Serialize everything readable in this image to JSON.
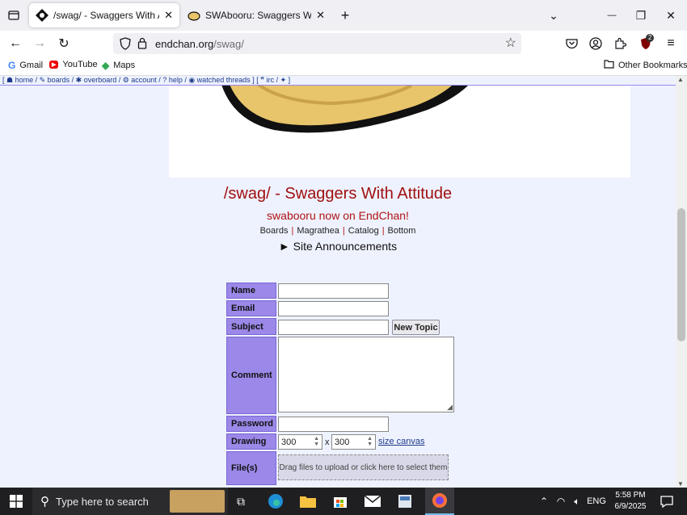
{
  "tabs": [
    {
      "title": "/swag/ - Swaggers With Attitud",
      "close": "✕"
    },
    {
      "title": "SWAbooru: Swaggers With Atti",
      "close": "✕"
    }
  ],
  "new_tab": "+",
  "window_controls": {
    "list": "⌄",
    "minimize": "—",
    "restore": "❐",
    "close": "✕"
  },
  "address": {
    "host": "endchan.org",
    "path": "/swag/"
  },
  "bookmarks": [
    {
      "label": "Gmail",
      "icon": "G"
    },
    {
      "label": "YouTube",
      "icon": "▶"
    },
    {
      "label": "Maps",
      "icon": "◆"
    }
  ],
  "other_bookmarks": "Other Bookmarks",
  "extension_badge": "2",
  "top_nav": "[ ☗ home / ✎ boards / ✱ overboard / ⚙ account / ? help / ◉ watched threads  ] [ ❞ irc / ✦ ]",
  "board_title": "/swag/ - Swaggers With Attitude",
  "board_subtitle": "swabooru now on EndChan!",
  "nav_links": [
    "Boards",
    "Magrathea",
    "Catalog",
    "Bottom"
  ],
  "announcements": "► Site Announcements",
  "form": {
    "name_label": "Name",
    "email_label": "Email",
    "subject_label": "Subject",
    "new_topic_button": "New Topic",
    "comment_label": "Comment",
    "password_label": "Password",
    "drawing_label": "Drawing",
    "drawing_width": "300",
    "drawing_height": "300",
    "drawing_x": "x",
    "size_canvas_link": "size canvas",
    "files_label": "File(s)",
    "dropzone_text": "Drag files to upload or click here to select them"
  },
  "taskbar": {
    "search_placeholder": "Type here to search",
    "language": "ENG",
    "time": "5:58 PM",
    "date": "6/9/2025"
  }
}
